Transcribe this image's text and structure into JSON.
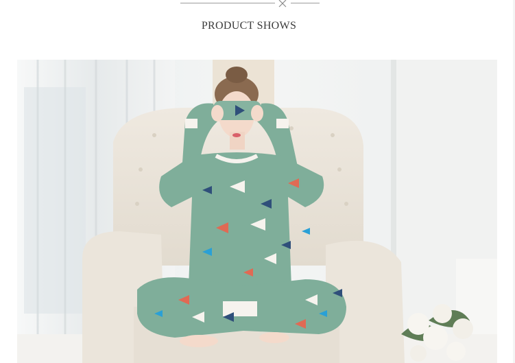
{
  "section": {
    "title": "PRODUCT SHOWS"
  },
  "photo": {
    "subject": "woman-in-pajamas-on-armchair",
    "colors": {
      "pajama": "#7fae9a",
      "chair": "#ece6dc",
      "wall": "#eef1f0",
      "window": "#dfe6e8",
      "floor": "#f3f2ef",
      "roses": "#f5f3ee",
      "leaves": "#5f7d56"
    }
  },
  "decor": {
    "divider_icon": "cross-icon"
  }
}
